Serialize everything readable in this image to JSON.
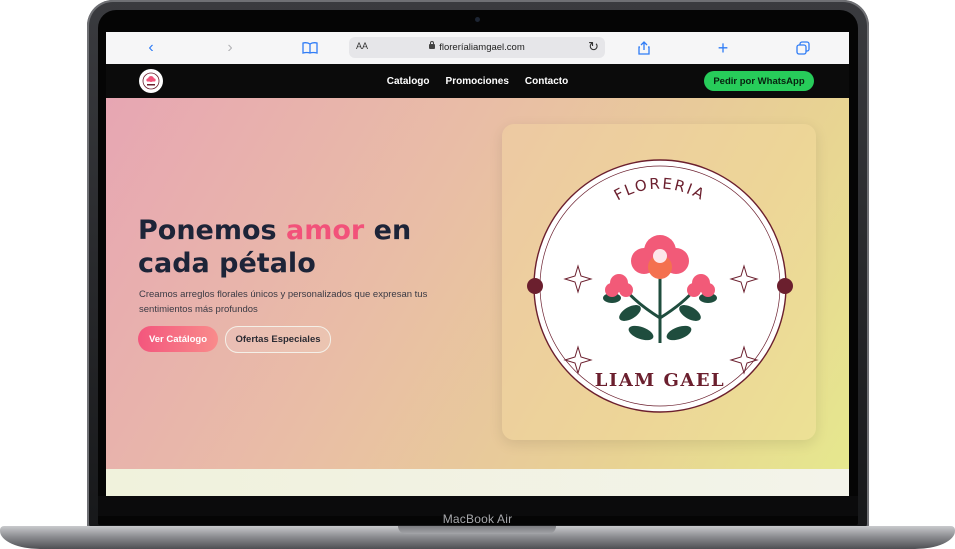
{
  "browser": {
    "url": "floreríaliamgael.com",
    "reader_label": "AA"
  },
  "nav": {
    "links": [
      "Catalogo",
      "Promociones",
      "Contacto"
    ],
    "cta": "Pedir por WhatsApp"
  },
  "hero": {
    "title_start": "Ponemos ",
    "title_accent": "amor",
    "title_end": " en cada pétalo",
    "description": "Creamos arreglos florales únicos y personalizados que expresan tus sentimientos más profundos",
    "primary_button": "Ver Catálogo",
    "secondary_button": "Ofertas Especiales"
  },
  "logo": {
    "top_text": "FLORERIA",
    "bottom_text": "LIAM GAEL"
  },
  "device": {
    "model": "MacBook Air"
  },
  "colors": {
    "accent": "#f2527a",
    "whatsapp": "#27cc5a",
    "logo_dark": "#6b1f2e"
  }
}
